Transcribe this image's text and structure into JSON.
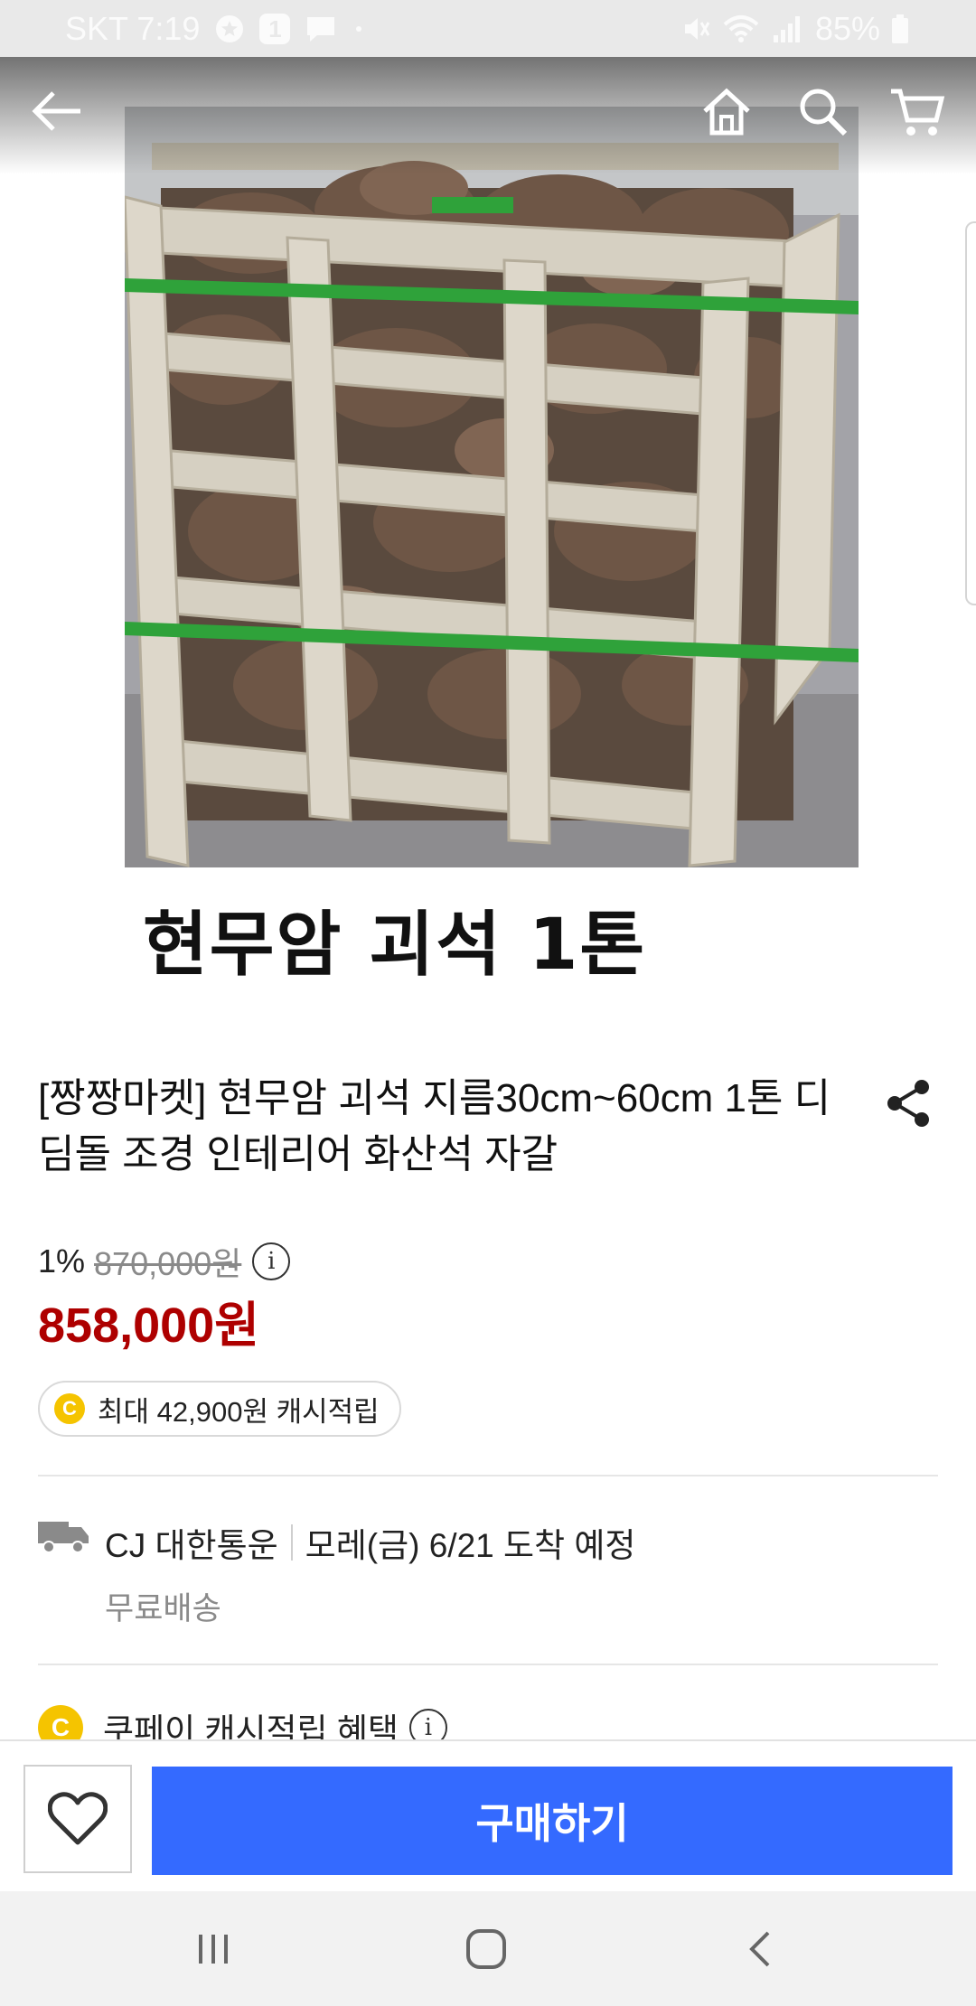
{
  "status_bar": {
    "carrier_time": "SKT 7:19",
    "notification_count": "1",
    "battery": "85%"
  },
  "header": {
    "icons": [
      "back-arrow-icon",
      "home-icon",
      "search-icon",
      "cart-icon"
    ]
  },
  "product_image": {
    "caption": "현무암 괴석 1톤"
  },
  "product": {
    "title": "[짱짱마켓] 현무암 괴석 지름30cm~60cm 1톤 디딤돌 조경 인테리어 화산석 자갈",
    "discount_rate": "1%",
    "original_price": "870,000원",
    "sale_price": "858,000원",
    "cashback_coin": "C",
    "cashback": "최대 42,900원 캐시적립"
  },
  "shipping": {
    "carrier": "CJ 대한통운",
    "arrival": "모레(금) 6/21 도착 예정",
    "fee": "무료배송"
  },
  "coupay": {
    "coin": "C",
    "label": "쿠페이 캐시적립 혜택"
  },
  "buy_bar": {
    "buy_label": "구매하기"
  },
  "colors": {
    "accent": "#346aff",
    "sale_price": "#ae0000",
    "coin": "#f5c400"
  }
}
